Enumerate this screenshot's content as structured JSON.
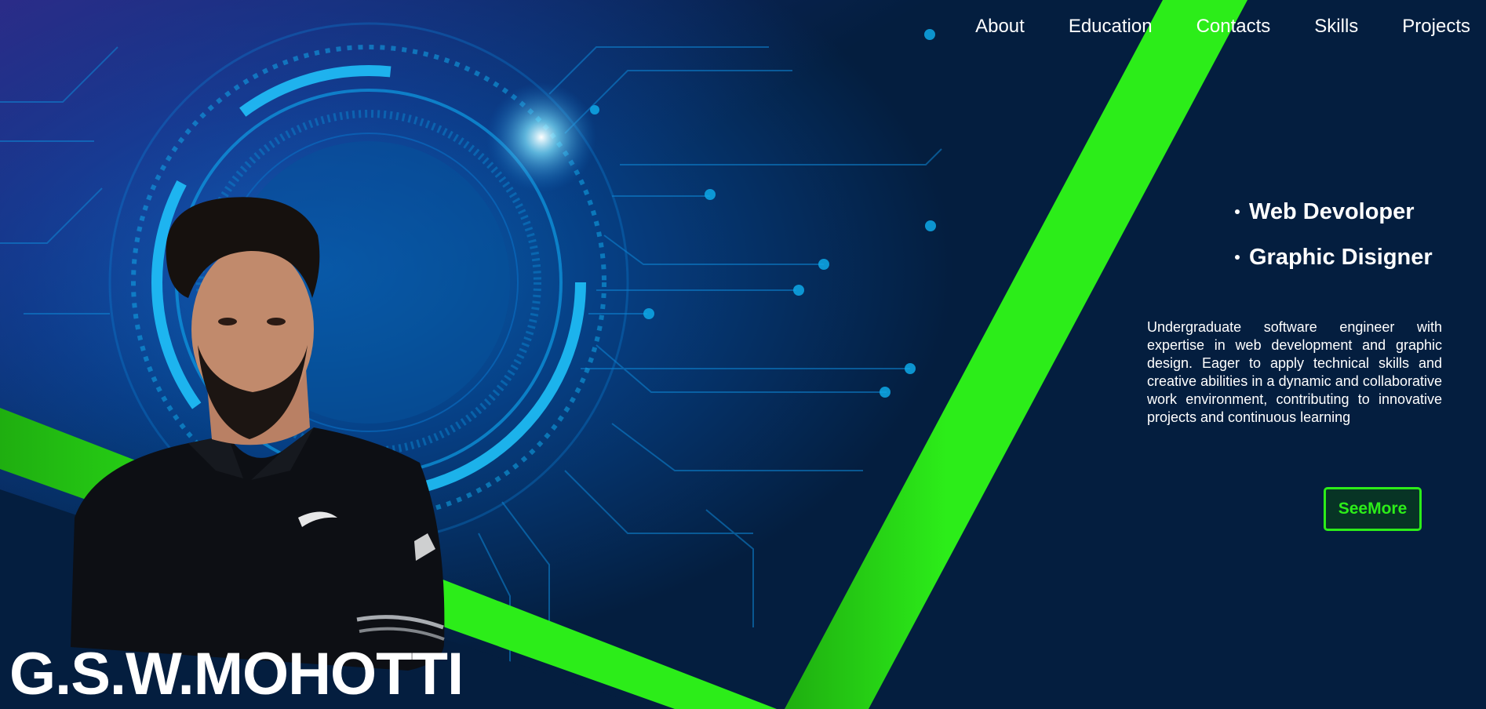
{
  "nav": {
    "items": [
      {
        "label": "About"
      },
      {
        "label": "Education"
      },
      {
        "label": "Contacts"
      },
      {
        "label": "Skills"
      },
      {
        "label": "Projects"
      }
    ]
  },
  "hero": {
    "roles": [
      "Web Devoloper",
      "Graphic Disigner"
    ],
    "summary": "Undergraduate software engineer with expertise in web development and graphic design. Eager to apply technical skills and creative abilities in a dynamic and collaborative work environment, contributing to innovative projects and continuous learning",
    "button_label": "SeeMore",
    "name": "G.S.W.MOHOTTI"
  },
  "colors": {
    "background": "#041e3f",
    "accent_green": "#2ced19",
    "circuit_blue": "#0a6fc4",
    "text": "#ffffff"
  },
  "icons": {
    "role_bullet": "bullet-dot-icon"
  }
}
